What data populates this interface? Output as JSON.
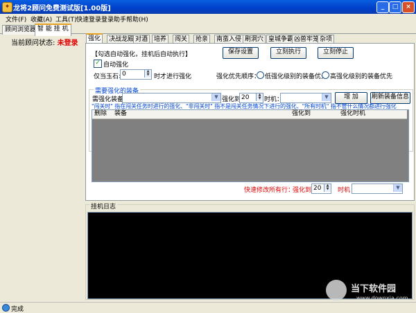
{
  "window": {
    "title": "龙将2顾问免费测试版[1.00版]",
    "controls": [
      "_",
      "□",
      "×"
    ]
  },
  "menu": [
    "文件(F)",
    "收藏(A)",
    "工具(T)",
    "快速登录",
    "登录助手",
    "帮助(H)"
  ],
  "main_tabs": [
    "顾问浏览器",
    "智 能 挂 机"
  ],
  "status": {
    "label": "当前顾问状态:",
    "value": "未登录"
  },
  "sub_tabs": [
    "强化",
    "决战龙殿",
    "对酒",
    "培养",
    "闯关",
    "抢亲",
    "南蛮入侵",
    "刷洞穴",
    "皇城争霸",
    "凶兽牢笼",
    "杂项"
  ],
  "strength": {
    "hint": "【勾选自动强化，挂机后自动执行】",
    "save_btn": "保存设置",
    "exec_btn": "立刻执行",
    "stop_btn": "立刻停止",
    "auto_label": "自动强化",
    "auto_checked": "✓",
    "jade_prefix": "仅当玉石>",
    "jade_value": "0",
    "jade_suffix": "时才进行强化",
    "priority_label": "强化优先顺序：",
    "priority_low": "低强化级别的装备优先",
    "priority_high": "高强化级别的装备优先",
    "group_title": "需要强化的装备",
    "equip_label": "需强化装备",
    "equip_value": "",
    "level_label": "强化到",
    "level_value": "20",
    "time_label": "时机：",
    "time_value": "",
    "add_btn": "增 加",
    "refresh_btn": "刷新装备信息",
    "note": "\"闯关时\" 指在闯关任务时进行的强化、\"非闯关时\" 指不是闯关任务情况下进行的强化、\"所有时机\" 指不管什么情况都进行强化",
    "table_headers": [
      "删除",
      "装备",
      "强化到",
      "强化时机"
    ],
    "quick_label": "快速修改所有行：",
    "quick_level_label": "强化到",
    "quick_level_value": "20",
    "quick_time_label": "时机",
    "quick_time_value": ""
  },
  "log": {
    "title": "挂机日志"
  },
  "statusbar": {
    "text": "完成"
  },
  "watermark": {
    "text": "当下软件园",
    "url": "www.downxia.com"
  }
}
